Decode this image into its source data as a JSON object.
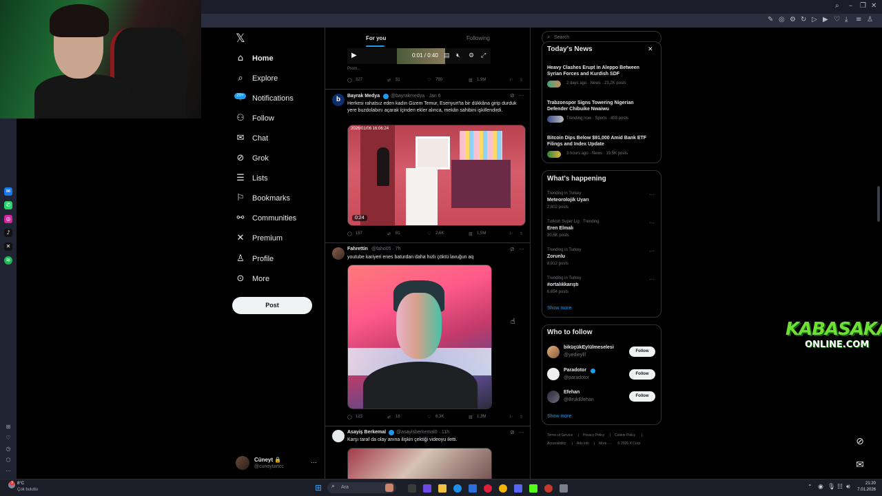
{
  "webcam": {
    "label": "streamer webcam"
  },
  "left_dock": {
    "icons": [
      "messenger-icon",
      "whatsapp-icon",
      "instagram-icon",
      "tiktok-icon",
      "x-icon",
      "spotify-icon"
    ]
  },
  "x_logo": "𝕏",
  "nav": {
    "items": [
      {
        "icon": "home-icon",
        "glyph": "⌂",
        "label": "Home"
      },
      {
        "icon": "explore-icon",
        "glyph": "⌕",
        "label": "Explore"
      },
      {
        "icon": "bell-icon",
        "glyph": "♢",
        "label": "Notifications"
      },
      {
        "icon": "follow-icon",
        "glyph": "⚇",
        "label": "Follow"
      },
      {
        "icon": "chat-icon",
        "glyph": "✉",
        "label": "Chat"
      },
      {
        "icon": "grok-icon",
        "glyph": "⊘",
        "label": "Grok"
      },
      {
        "icon": "lists-icon",
        "glyph": "☰",
        "label": "Lists"
      },
      {
        "icon": "bookmark-icon",
        "glyph": "⚐",
        "label": "Bookmarks"
      },
      {
        "icon": "communities-icon",
        "glyph": "⚯",
        "label": "Communities"
      },
      {
        "icon": "premium-icon",
        "glyph": "✕",
        "label": "Premium"
      },
      {
        "icon": "profile-icon",
        "glyph": "♙",
        "label": "Profile"
      },
      {
        "icon": "more-icon",
        "glyph": "⊙",
        "label": "More"
      }
    ],
    "notif_badge": "20+",
    "post_label": "Post"
  },
  "account": {
    "name": "Cüneyt 🔒",
    "handle": "@cuneytartcc"
  },
  "feed": {
    "tabs": [
      "For you",
      "Following"
    ],
    "video_bar": {
      "time": "0:01 / 0:40",
      "promo": "Prom..."
    },
    "tweet0_actions": [
      "327",
      "51",
      "790",
      "1,9M"
    ],
    "tweets": [
      {
        "name": "Bayrak Medya",
        "meta": "@bayrakmedya · Jan 6",
        "text": "Herkesi rahatsız eden kadın Gizem Temur, Esenyurt'ta bir dükkâna girip durduk yere buzdolabını açarak içinden ekler alınca, mekân sahibini işkillendirdi.",
        "video_stamp": "2026/01/06 16:06:24",
        "video_duration": "0:24",
        "actions": [
          "157",
          "81",
          "2,6K",
          "1,5M"
        ]
      },
      {
        "name": "Fahrettin",
        "meta": "@faho05 · 7h",
        "text": "youtube kariyeri enes baturdan daha hızlı çöktü lavuğun aq",
        "actions": [
          "123",
          "18",
          "6,3K",
          "1,3M"
        ]
      },
      {
        "name": "Asayiş Berkemal",
        "meta": "@asayisberkemal0 · 11h",
        "text": "Karşı taraf da olay anına ilişkin çektiği videoyu iletti."
      }
    ]
  },
  "right": {
    "search_placeholder": "Search",
    "news": {
      "title": "Today's News",
      "items": [
        {
          "title": "Heavy Clashes Erupt in Aleppo Between Syrian Forces and Kurdish SDF",
          "meta": "2 days ago · News · 23,2K posts"
        },
        {
          "title": "Trabzonspor Signs Towering Nigerian Defender Chibuike Nwaiwu",
          "meta": "Trending now · Sports · 403 posts"
        },
        {
          "title": "Bitcoin Dips Below $91,000 Amid Bank ETF Filings and Index Update",
          "meta": "3 hours ago · News · 19,5K posts"
        }
      ]
    },
    "happening": {
      "title": "What's happening",
      "items": [
        {
          "context": "Trending in Turkey",
          "name": "Meteorolojik Uyarı",
          "count": "2,602 posts"
        },
        {
          "context": "Turkish Super Lig · Trending",
          "name": "Eren Elmalı",
          "count": "30,6K posts"
        },
        {
          "context": "Trending in Turkey",
          "name": "Zorunlu",
          "count": "8,912 posts"
        },
        {
          "context": "Trending in Turkey",
          "name": "#ortalıkkarıştı",
          "count": "6,654 posts"
        }
      ],
      "show_more": "Show more"
    },
    "who_to_follow": {
      "title": "Who to follow",
      "items": [
        {
          "name": "biküçükEylülmeselesi",
          "handle": "@yedieylll",
          "button": "Follow"
        },
        {
          "name": "Paradotor",
          "handle": "@paradotor",
          "button": "Follow"
        },
        {
          "name": "Efehan",
          "handle": "@BrukEfehan",
          "button": "Follow"
        }
      ],
      "show_more": "Show more"
    },
    "footer": [
      "Terms of Service",
      "|",
      "Privacy Policy",
      "|",
      "Cookie Policy",
      "|",
      "Accessibility",
      "|",
      "Ads info",
      "|",
      "More ···",
      "© 2026 X Corp."
    ]
  },
  "overlay": {
    "brand_line1": "KABASAKAL",
    "brand_line2": "ONLINE.COM"
  },
  "taskbar": {
    "weather_temp": "8°C",
    "weather_desc": "Çok bulutlu",
    "search_placeholder": "Ara",
    "time": "21:20",
    "date": "7.01.2026"
  }
}
